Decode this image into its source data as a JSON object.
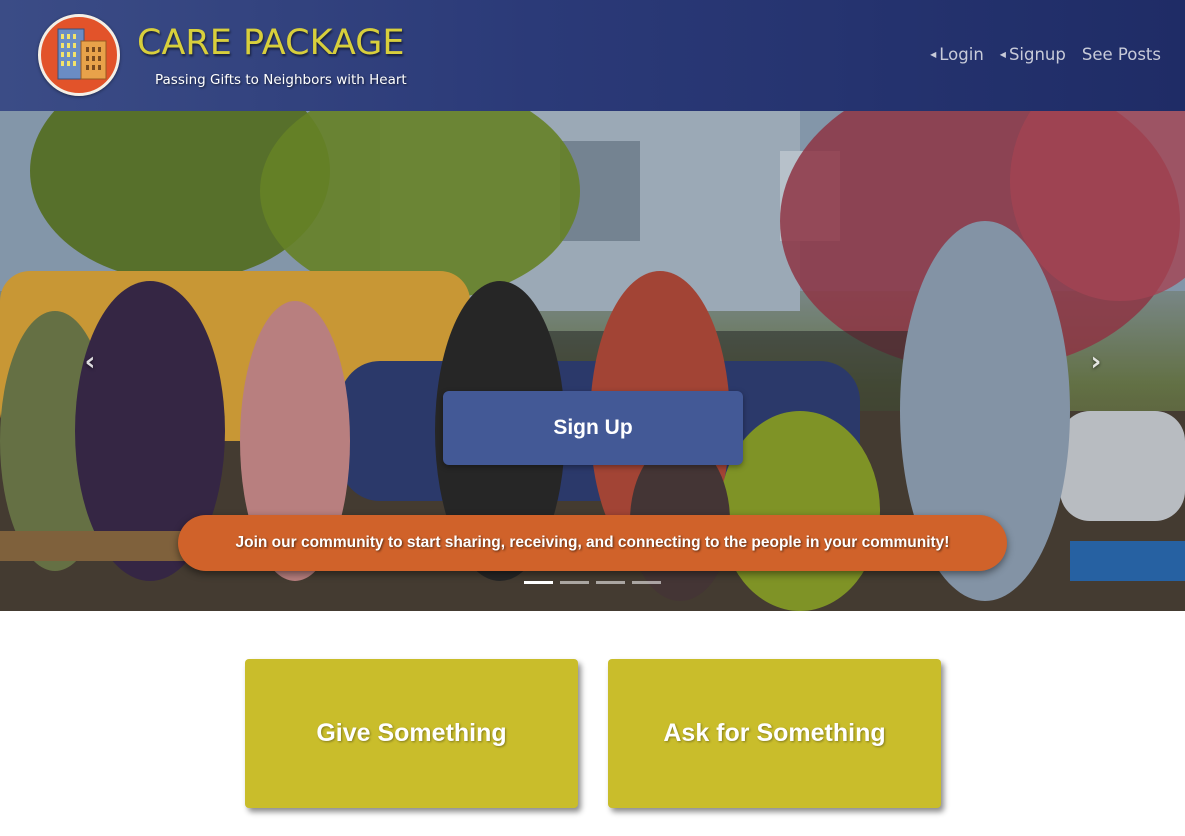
{
  "header": {
    "brand_title": "CARE PACKAGE",
    "brand_subtitle": "Passing Gifts to Neighbors with Heart",
    "logo_icon": "buildings-logo-icon",
    "nav": [
      {
        "label": "Login",
        "has_caret": true
      },
      {
        "label": "Signup",
        "has_caret": true
      },
      {
        "label": "See Posts",
        "has_caret": false
      }
    ]
  },
  "hero": {
    "cta_label": "Sign Up",
    "caption": "Join our community to start sharing, receiving, and connecting to the people in your community!",
    "prev_icon": "chevron-left-icon",
    "next_icon": "chevron-right-icon",
    "slide_count": 4,
    "active_slide": 1
  },
  "tiles": {
    "give_label": "Give Something",
    "ask_label": "Ask for Something"
  },
  "colors": {
    "header_blue": "#2b3a78",
    "brand_yellow": "#d8cf3c",
    "cta_blue": "#435996",
    "caption_orange": "#d0622a",
    "tile_olive": "#c9bd2b"
  }
}
